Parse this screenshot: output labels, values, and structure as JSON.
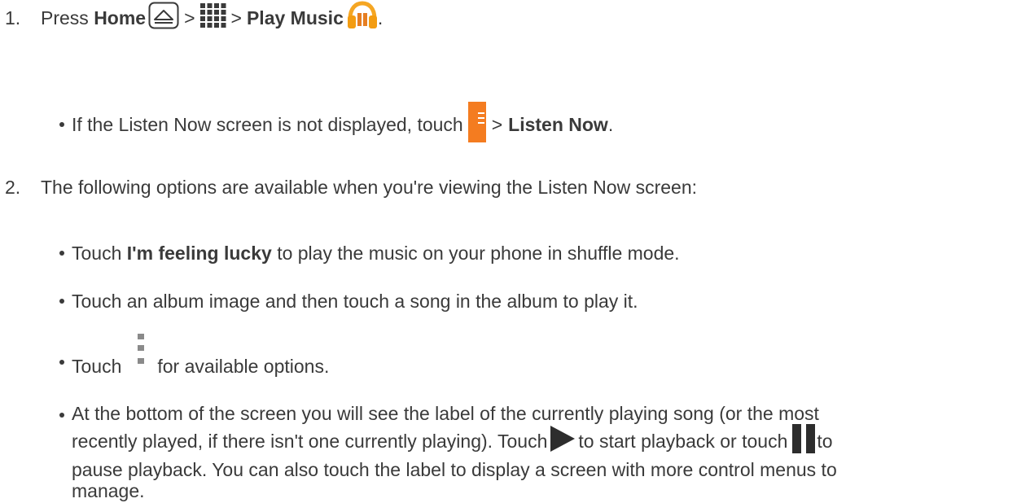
{
  "step1": {
    "number": "1.",
    "text_press": "Press",
    "home_label": "Home",
    "sep1": ">",
    "sep2": ">",
    "play_music_label": "Play Music",
    "end_period": "."
  },
  "step1_bullet": {
    "text_before": "If the Listen Now screen is not displayed, touch",
    "sep": ">",
    "listen_now_label": "Listen Now",
    "end_period": "."
  },
  "step2": {
    "number": "2.",
    "text": "The following options are available when you're viewing the Listen Now screen:"
  },
  "step2_bullets": {
    "b1_touch": "Touch",
    "b1_bold": "I'm feeling lucky",
    "b1_rest": "to play the music on your phone in shuffle mode.",
    "b2_text": "Touch an album image and then touch a song in the album to play it.",
    "b3_touch": "Touch",
    "b3_rest": "for available options.",
    "b4_line1": "At the bottom of the screen you will see the label of the currently playing song (or the most",
    "b4_line2_a": "recently played, if there isn't one currently playing). Touch",
    "b4_line2_b": "to start playback or touch",
    "b4_line2_c": "to",
    "b4_line3": "pause playback. You can also touch the label to display a screen with more control menus to",
    "b4_line4": "manage."
  },
  "icons": {
    "home": "home-button-icon",
    "apps": "apps-grid-icon",
    "play_music": "play-music-headphones-icon",
    "menu": "orange-menu-icon",
    "overflow": "overflow-menu-icon",
    "play": "play-icon",
    "pause": "pause-icon"
  },
  "colors": {
    "text": "#3a3a3a",
    "accent_orange": "#f47c20"
  }
}
